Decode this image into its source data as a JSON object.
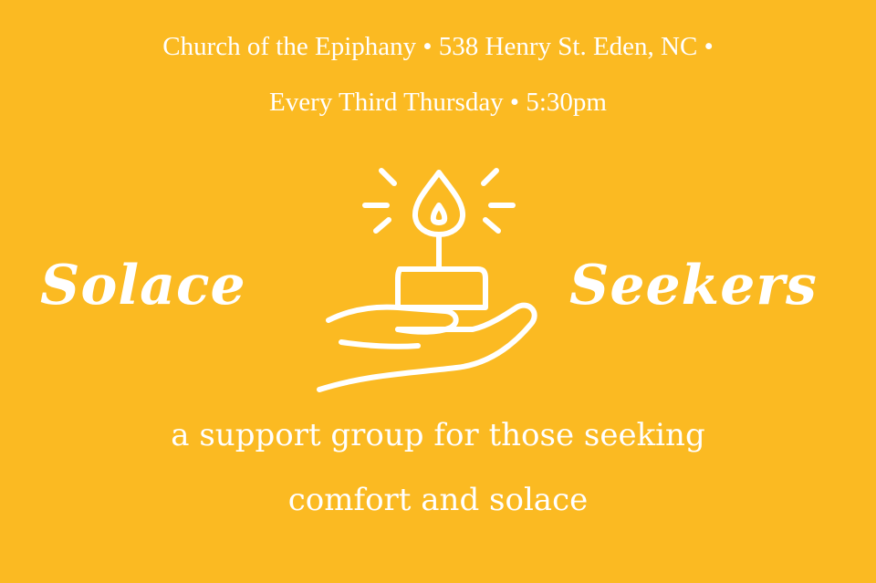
{
  "header": {
    "line1": "Church of the Epiphany • 538 Henry St. Eden, NC •",
    "line2": "Every Third Thursday • 5:30pm"
  },
  "title": {
    "left_word": "Solace",
    "right_word": "Seekers"
  },
  "logo": {
    "icon": "candle-in-hand-icon"
  },
  "tagline": {
    "line1": "a support group for those seeking",
    "line2": "comfort and solace"
  },
  "colors": {
    "background": "#FBBA22",
    "foreground": "#FFFFFF"
  }
}
